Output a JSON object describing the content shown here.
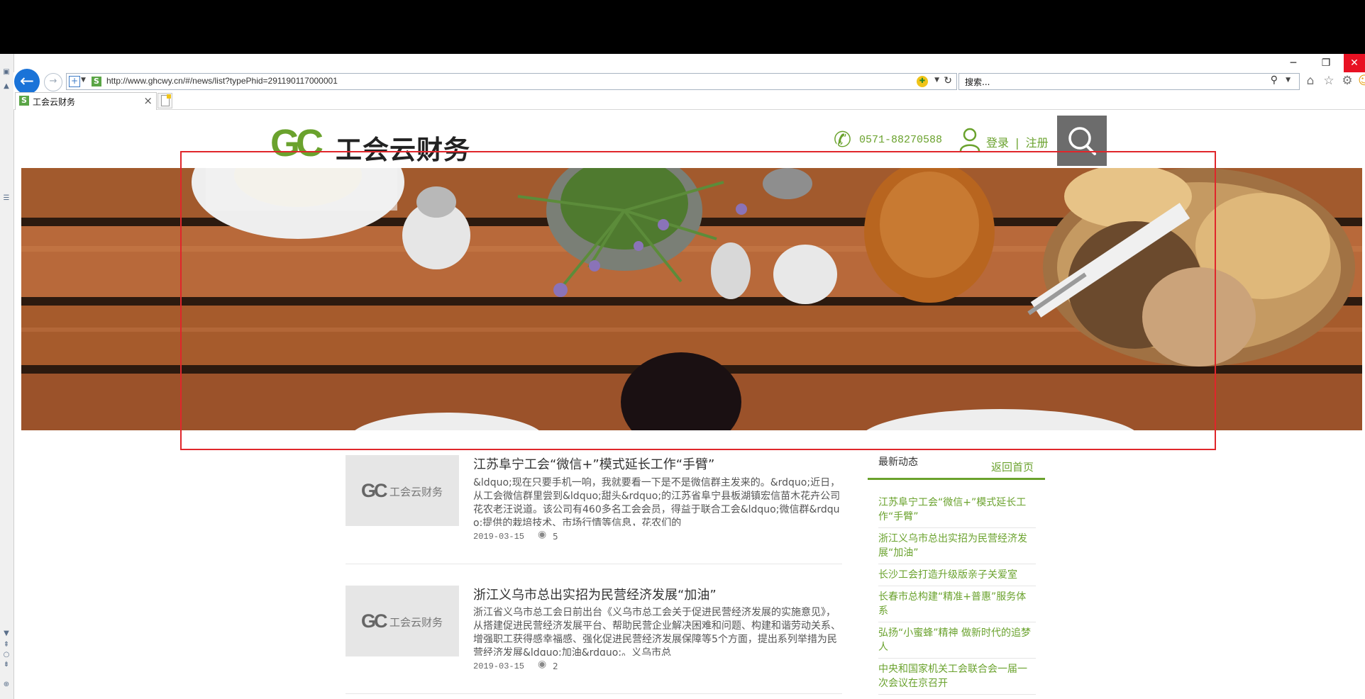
{
  "browser": {
    "window_controls": {
      "minimize": "─",
      "restore": "❐",
      "close": "✕"
    },
    "address": {
      "url": "http://www.ghcwy.cn/#/news/list?typePhid=291190117000001"
    },
    "search": {
      "placeholder": "搜索..."
    },
    "tab": {
      "title": "工会云财务",
      "close": "×"
    }
  },
  "site": {
    "logo": {
      "mark": "GC",
      "name": "工会云财务"
    },
    "phone": "0571-88270588",
    "auth": {
      "login": "登录",
      "divider": "|",
      "register": "注册"
    }
  },
  "news": [
    {
      "title": "江苏阜宁工会“微信+”模式延长工作“手臂”",
      "summary": "&ldquo;现在只要手机一响，我就要看一下是不是微信群主发来的。&rdquo;近日，从工会微信群里尝到&ldquo;甜头&rdquo;的江苏省阜宁县板湖镇宏信苗木花卉公司花农老汪说道。该公司有460多名工会会员，得益于联合工会&ldquo;微信群&rdquo;提供的栽培技术、市场行情等信息，花农们的",
      "date": "2019-03-15",
      "views": "5",
      "thumb": {
        "mark": "GC",
        "text": "工会云财务"
      }
    },
    {
      "title": "浙江义乌市总出实招为民营经济发展“加油”",
      "summary": "浙江省义乌市总工会日前出台《义乌市总工会关于促进民营经济发展的实施意见》，从搭建促进民营经济发展平台、帮助民营企业解决困难和问题、构建和谐劳动关系、增强职工获得感幸福感、强化促进民营经济发展保障等5个方面，提出系列举措为民营经济发展&ldquo;加油&rdquo;。义乌市总",
      "date": "2019-03-15",
      "views": "2",
      "thumb": {
        "mark": "GC",
        "text": "工会云财务"
      }
    }
  ],
  "sidebar": {
    "title": "最新动态",
    "home_link": "返回首页",
    "items": [
      "江苏阜宁工会“微信+”模式延长工作“手臂”",
      "浙江义乌市总出实招为民营经济发展“加油”",
      "长沙工会打造升级版亲子关爱室",
      "长春市总构建“精准+普惠”服务体系",
      "弘扬“小蜜蜂”精神 做新时代的追梦人",
      "中央和国家机关工会联合会一届一次会议在京召开"
    ]
  },
  "colors": {
    "brand_green": "#6aa22d",
    "annotation_red": "#e0262b",
    "browser_blue": "#1a73d8"
  }
}
